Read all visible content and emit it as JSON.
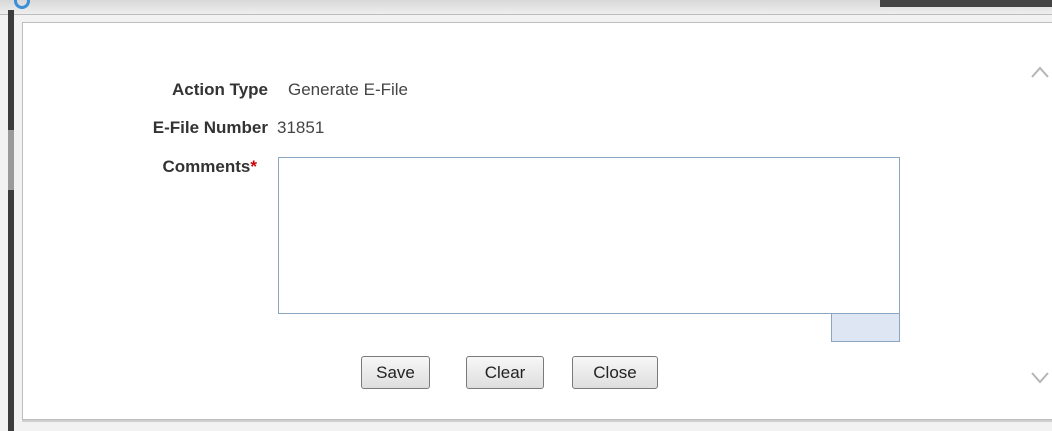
{
  "form": {
    "action_type": {
      "label": "Action Type",
      "value": "Generate E-File"
    },
    "efile_number": {
      "label": "E-File Number",
      "value": "31851"
    },
    "comments": {
      "label": "Comments",
      "required_marker": "*",
      "value": ""
    }
  },
  "buttons": {
    "save": "Save",
    "clear": "Clear",
    "close": "Close"
  },
  "icons": {
    "scroll_up": "chevron-up-icon",
    "scroll_down": "chevron-down-icon"
  },
  "colors": {
    "required": "#cc0000",
    "textarea_border": "#8aa6c0"
  }
}
